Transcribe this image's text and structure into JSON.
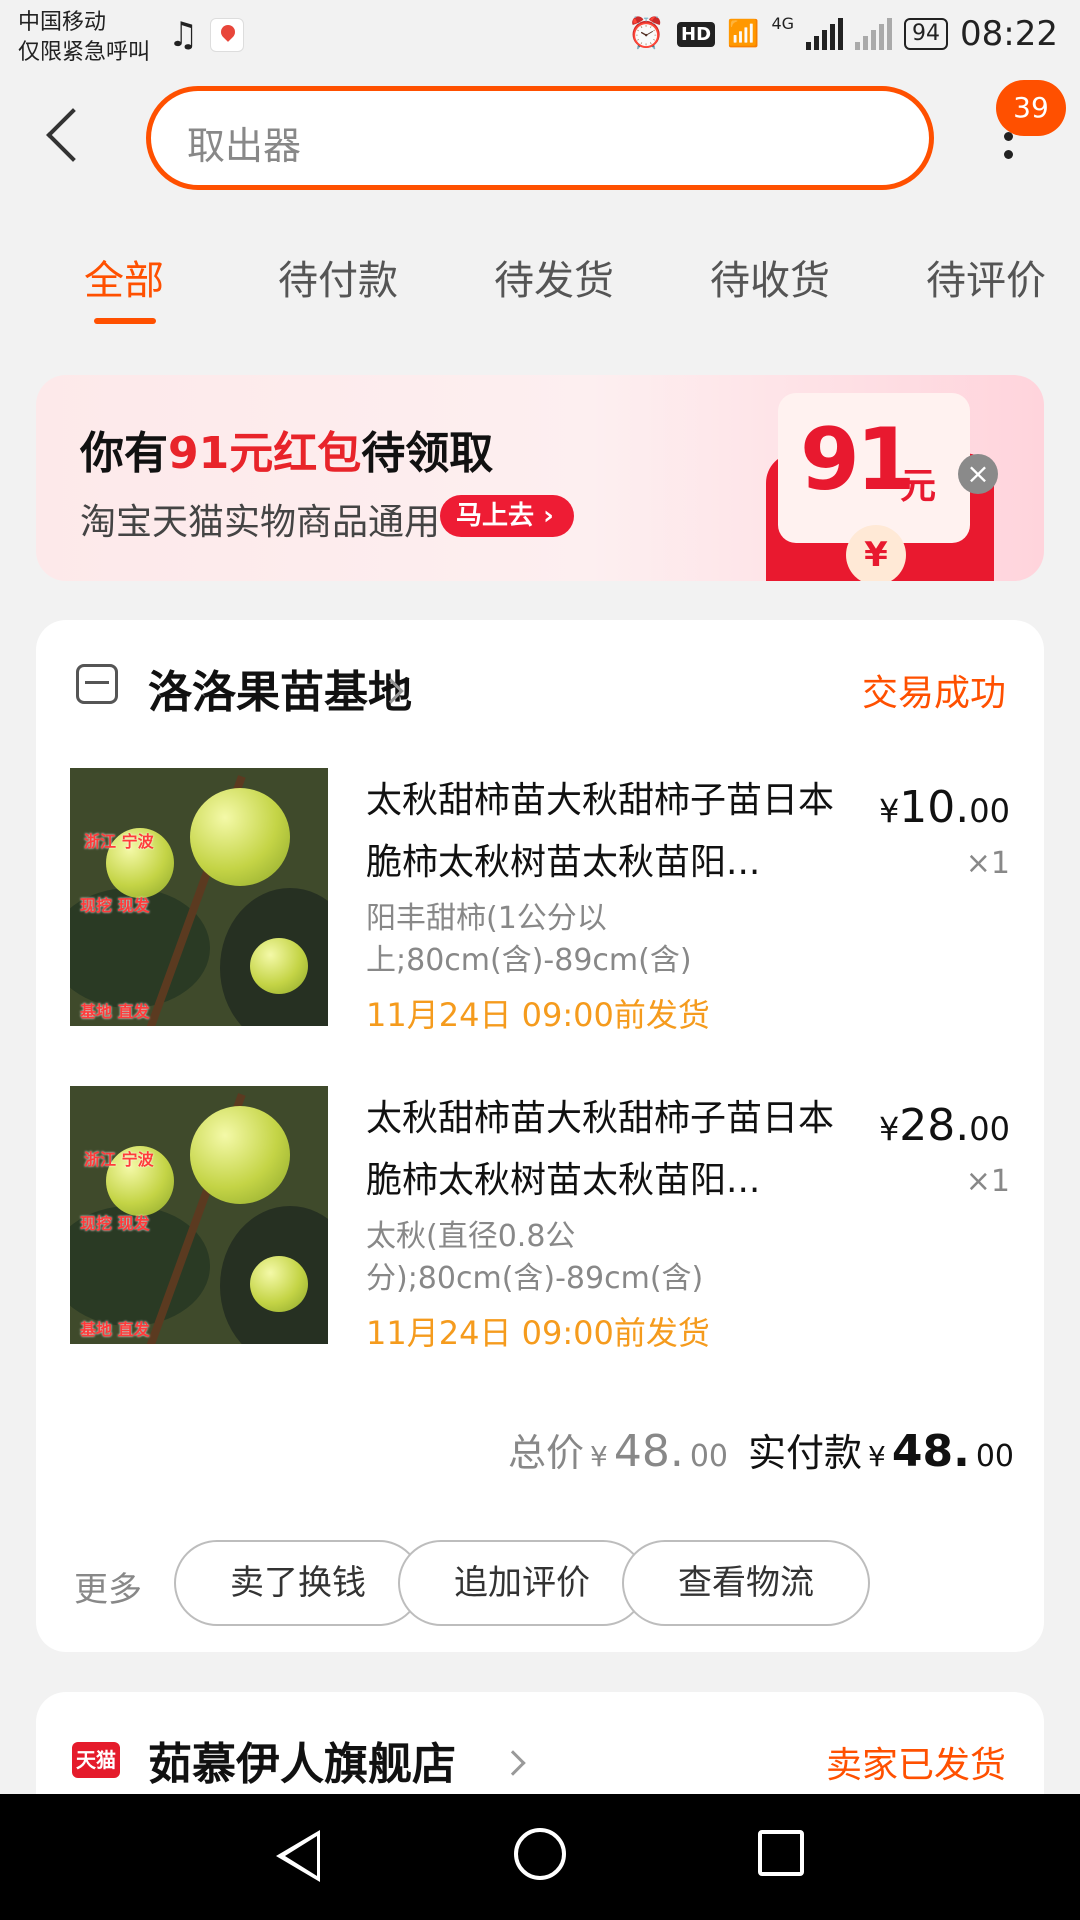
{
  "status_bar": {
    "carrier_line1": "中国移动",
    "carrier_line2": "仅限紧急呼叫",
    "battery": "94",
    "time": "08:22",
    "hd": "HD",
    "network": "4G"
  },
  "header": {
    "search_text": "取出器",
    "badge_count": "39"
  },
  "tabs": [
    {
      "label": "全部",
      "active": true
    },
    {
      "label": "待付款"
    },
    {
      "label": "待发货"
    },
    {
      "label": "待收货"
    },
    {
      "label": "待评价"
    }
  ],
  "banner": {
    "title_prefix": "你有",
    "title_highlight": "91元红包",
    "title_suffix": "待领取",
    "subtitle": "淘宝天猫实物商品通用",
    "button_label": "马上去",
    "amount": "91",
    "unit": "元",
    "coin": "¥"
  },
  "order": {
    "shop_name": "洛洛果苗基地",
    "status": "交易成功",
    "thumb_tags": [
      "浙江 宁波",
      "现挖 现发",
      "基地 直发"
    ],
    "items": [
      {
        "title": "太秋甜柿苗大秋甜柿子苗日本脆柿太秋树苗太秋苗阳...",
        "sku": "阳丰甜柿(1公分以上;80cm(含)-89cm(含)",
        "ship": "11月24日 09:00前发货",
        "price_symbol": "¥",
        "price_int": "10.",
        "price_dec": "00",
        "qty": "×1"
      },
      {
        "title": "太秋甜柿苗大秋甜柿子苗日本脆柿太秋树苗太秋苗阳...",
        "sku": "太秋(直径0.8公分);80cm(含)-89cm(含)",
        "ship": "11月24日 09:00前发货",
        "price_symbol": "¥",
        "price_int": "28.",
        "price_dec": "00",
        "qty": "×1"
      }
    ],
    "total_label": "总价",
    "total_symbol": "¥",
    "total_int": "48.",
    "total_dec": "00",
    "paid_label": "实付款",
    "paid_symbol": "¥",
    "paid_int": "48.",
    "paid_dec": "00",
    "more_label": "更多",
    "actions": [
      "卖了换钱",
      "追加评价",
      "查看物流"
    ]
  },
  "next_order": {
    "tmall_label": "天猫",
    "shop_name": "茹慕伊人旗舰店",
    "status": "卖家已发货"
  },
  "colors": {
    "accent": "#ff5000",
    "ship_text": "#f59b1d",
    "red": "#e8242a"
  }
}
